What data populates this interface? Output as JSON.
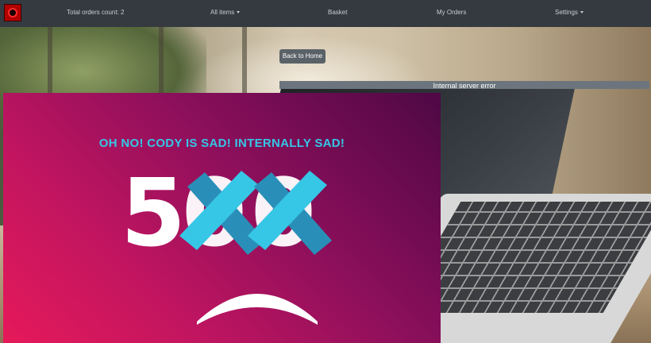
{
  "navbar": {
    "logo_icon": "logo-icon",
    "orders_count": "Total orders count: 2",
    "all_items": "All items",
    "basket": "Basket",
    "my_orders": "My Orders",
    "settings": "Settings"
  },
  "main": {
    "back_button": "Back to Home",
    "error_message": "Internal server error"
  },
  "error_panel": {
    "headline": "OH NO! CODY IS SAD! INTERNALLY SAD!",
    "digit_1": "5",
    "digit_2": "0",
    "digit_3": "0",
    "colors": {
      "cross": "#36c6e6",
      "cross_dark": "#2a8fb8",
      "headline": "#36c6e6",
      "gradient_start": "#e6195a",
      "gradient_end": "#4e0845"
    }
  }
}
